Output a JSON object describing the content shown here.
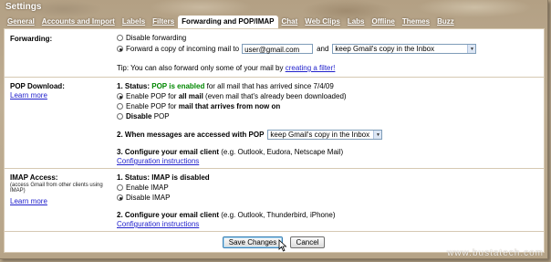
{
  "header": {
    "title": "Settings"
  },
  "tabs": [
    {
      "label": "General"
    },
    {
      "label": "Accounts and Import"
    },
    {
      "label": "Labels"
    },
    {
      "label": "Filters"
    },
    {
      "label": "Forwarding and POP/IMAP",
      "active": true
    },
    {
      "label": "Chat"
    },
    {
      "label": "Web Clips"
    },
    {
      "label": "Labs"
    },
    {
      "label": "Offline"
    },
    {
      "label": "Themes"
    },
    {
      "label": "Buzz"
    }
  ],
  "forwarding": {
    "title": "Forwarding:",
    "disable_label": "Disable forwarding",
    "forward_label": "Forward a copy of incoming mail to",
    "email_value": "user@gmail.com",
    "and_label": "and",
    "keep_option": "keep Gmail's copy in the Inbox",
    "tip_text": "Tip: You can also forward only some of your mail by",
    "tip_link": "creating a filter!"
  },
  "pop": {
    "title": "POP Download:",
    "learn_more": "Learn more",
    "status_prefix": "1. Status:",
    "status_value": "POP is enabled",
    "status_suffix": "for all mail that has arrived since 7/4/09",
    "opt_all_prefix": "Enable POP for",
    "opt_all_bold": "all mail",
    "opt_all_suffix": "(even mail that's already been downloaded)",
    "opt_now_prefix": "Enable POP for",
    "opt_now_bold": "mail that arrives from now on",
    "opt_disable": "Disable",
    "opt_disable_suffix": "POP",
    "when_label": "2. When messages are accessed with POP",
    "when_option": "keep Gmail's copy in the Inbox",
    "config_bold": "3. Configure your email client",
    "config_rest": "(e.g. Outlook, Eudora, Netscape Mail)",
    "config_link": "Configuration instructions"
  },
  "imap": {
    "title": "IMAP Access:",
    "desc": "(access Gmail from other clients using IMAP)",
    "learn_more": "Learn more",
    "status": "1. Status: IMAP is disabled",
    "enable_label": "Enable IMAP",
    "disable_label": "Disable IMAP",
    "config_bold": "2. Configure your email client",
    "config_rest": "(e.g. Outlook, Thunderbird, iPhone)",
    "config_link": "Configuration instructions"
  },
  "buttons": {
    "save": "Save Changes",
    "cancel": "Cancel"
  },
  "watermark": "www.bustatech.com"
}
